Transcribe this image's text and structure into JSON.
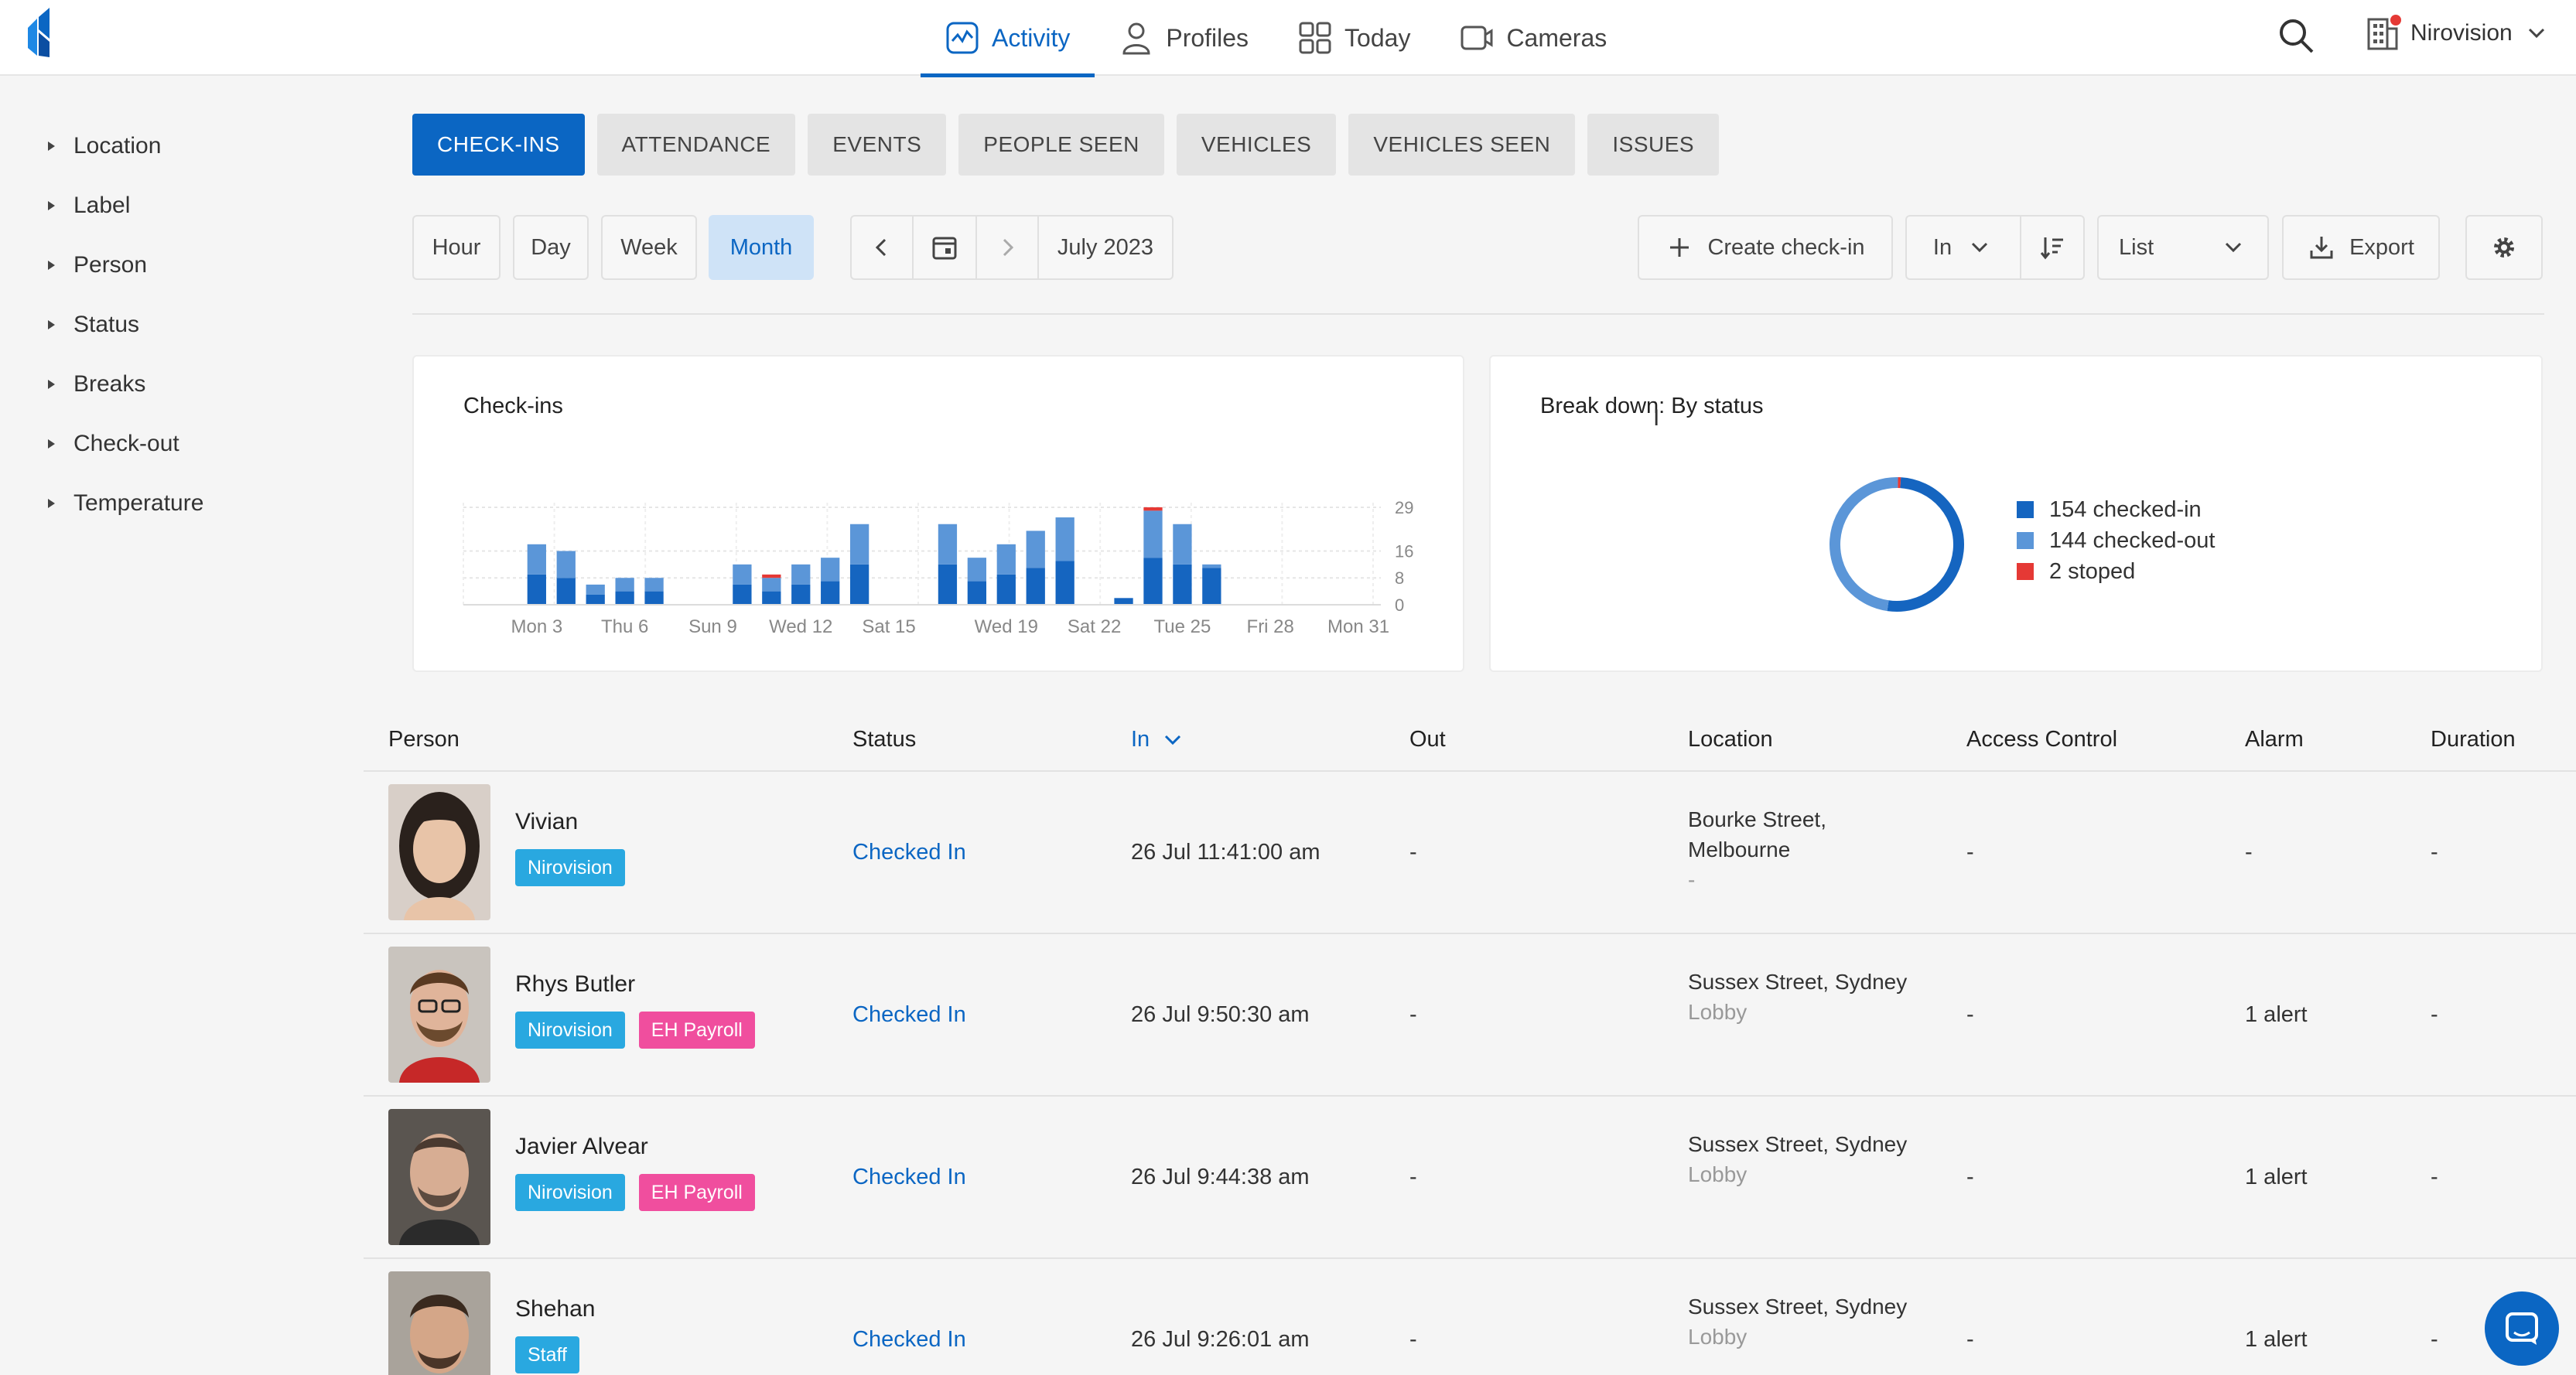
{
  "colors": {
    "accent": "#0b66c3",
    "checked_in": "#1565c0",
    "checked_out": "#5b96d8",
    "stopped": "#e53935",
    "tag_nirovision": "#29a8e0",
    "tag_eh_payroll": "#f04e9e",
    "tag_staff": "#29a8e0"
  },
  "nav": {
    "tabs": [
      {
        "label": "Activity",
        "icon": "activity-icon"
      },
      {
        "label": "Profiles",
        "icon": "person-icon"
      },
      {
        "label": "Today",
        "icon": "grid-icon"
      },
      {
        "label": "Cameras",
        "icon": "camera-icon"
      }
    ],
    "org_name": "Nirovision"
  },
  "filters": [
    "Location",
    "Label",
    "Person",
    "Status",
    "Breaks",
    "Check-out",
    "Temperature"
  ],
  "tabs": [
    "CHECK-INS",
    "ATTENDANCE",
    "EVENTS",
    "PEOPLE SEEN",
    "VEHICLES",
    "VEHICLES SEEN",
    "ISSUES"
  ],
  "toolbar": {
    "ranges": [
      "Hour",
      "Day",
      "Week",
      "Month"
    ],
    "selected_range": "Month",
    "period": "July 2023",
    "create_label": "Create check-in",
    "direction": "In",
    "view": "List",
    "export_label": "Export"
  },
  "checkins_card": {
    "title": "Check-ins"
  },
  "breakdown_card": {
    "title": "Break down: By status",
    "legend": [
      {
        "label": "154 checked-in",
        "color": "#1565c0"
      },
      {
        "label": "144 checked-out",
        "color": "#5b96d8"
      },
      {
        "label": "2 stoped",
        "color": "#e53935"
      }
    ]
  },
  "chart_data": [
    {
      "type": "bar",
      "title": "Check-ins",
      "stacked": true,
      "categories": [
        "1",
        "2",
        "3",
        "4",
        "5",
        "6",
        "7",
        "8",
        "9",
        "10",
        "11",
        "12",
        "13",
        "14",
        "15",
        "16",
        "17",
        "18",
        "19",
        "20",
        "21",
        "22",
        "23",
        "24",
        "25",
        "26",
        "27",
        "28",
        "29",
        "30",
        "31"
      ],
      "x_tick_labels": [
        "Mon 3",
        "Thu 6",
        "Sun 9",
        "Wed 12",
        "Sat 15",
        "Wed 19",
        "Sat 22",
        "Tue 25",
        "Fri 28",
        "Mon 31"
      ],
      "y_tick_labels": [
        "0",
        "8",
        "16",
        "29"
      ],
      "ylim": [
        0,
        29
      ],
      "series": [
        {
          "name": "checked-in",
          "values": [
            0,
            0,
            9,
            8,
            3,
            4,
            4,
            0,
            0,
            6,
            4,
            6,
            7,
            12,
            0,
            0,
            12,
            7,
            9,
            11,
            13,
            0,
            2,
            14,
            12,
            11,
            0,
            0,
            0,
            0,
            0
          ]
        },
        {
          "name": "checked-out",
          "values": [
            0,
            0,
            9,
            8,
            3,
            4,
            4,
            0,
            0,
            6,
            4,
            6,
            7,
            12,
            0,
            0,
            12,
            7,
            9,
            11,
            13,
            0,
            0,
            14,
            12,
            1,
            0,
            0,
            0,
            0,
            0
          ]
        },
        {
          "name": "stoped",
          "values": [
            0,
            0,
            0,
            0,
            0,
            0,
            0,
            0,
            0,
            0,
            1,
            0,
            0,
            0,
            0,
            0,
            0,
            0,
            0,
            0,
            0,
            0,
            0,
            1,
            0,
            0,
            0,
            0,
            0,
            0,
            0
          ]
        }
      ],
      "grid": true
    },
    {
      "type": "pie",
      "donut": true,
      "title": "Break down: By status",
      "categories": [
        "checked-in",
        "checked-out",
        "stoped"
      ],
      "values": [
        154,
        144,
        2
      ]
    }
  ],
  "table": {
    "columns": [
      "Person",
      "Status",
      "In",
      "Out",
      "Location",
      "Access Control",
      "Alarm",
      "Duration"
    ],
    "rows": [
      {
        "name": "Vivian",
        "tags": [
          {
            "label": "Nirovision",
            "kind": "nirovision"
          }
        ],
        "status": "Checked In",
        "in": "26 Jul 11:41:00 am",
        "out": "-",
        "location": "Bourke Street, Melbourne",
        "location_sub": "-",
        "access": "-",
        "alarm": "-",
        "duration": "-"
      },
      {
        "name": "Rhys Butler",
        "tags": [
          {
            "label": "Nirovision",
            "kind": "nirovision"
          },
          {
            "label": "EH Payroll",
            "kind": "eh"
          }
        ],
        "status": "Checked In",
        "in": "26 Jul 9:50:30 am",
        "out": "-",
        "location": "Sussex Street, Sydney",
        "location_sub": "Lobby",
        "access": "-",
        "alarm": "1 alert",
        "duration": "-"
      },
      {
        "name": "Javier Alvear",
        "tags": [
          {
            "label": "Nirovision",
            "kind": "nirovision"
          },
          {
            "label": "EH Payroll",
            "kind": "eh"
          }
        ],
        "status": "Checked In",
        "in": "26 Jul 9:44:38 am",
        "out": "-",
        "location": "Sussex Street, Sydney",
        "location_sub": "Lobby",
        "access": "-",
        "alarm": "1 alert",
        "duration": "-"
      },
      {
        "name": "Shehan",
        "tags": [
          {
            "label": "Staff",
            "kind": "staff"
          }
        ],
        "status": "Checked In",
        "in": "26 Jul 9:26:01 am",
        "out": "-",
        "location": "Sussex Street, Sydney",
        "location_sub": "Lobby",
        "access": "-",
        "alarm": "1 alert",
        "duration": "-"
      }
    ]
  }
}
